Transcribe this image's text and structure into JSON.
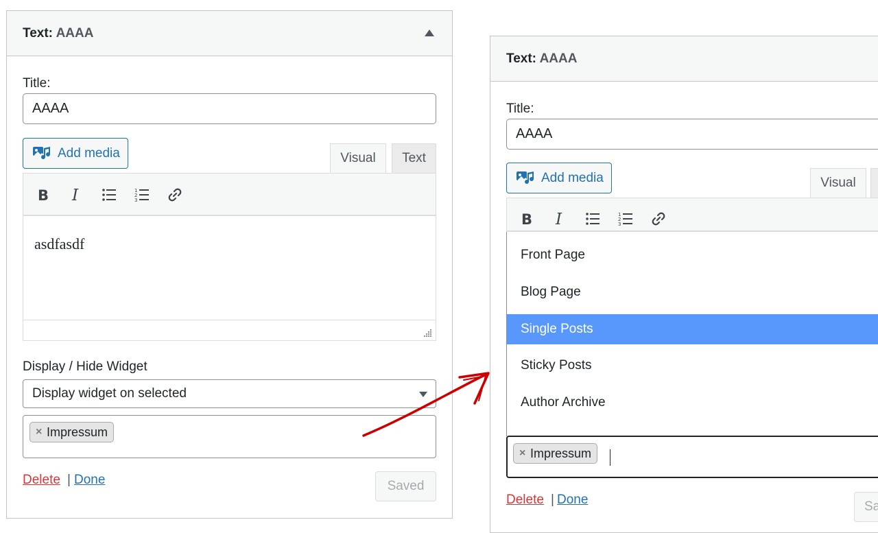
{
  "widget": {
    "type_label": "Text",
    "name": "AAAA",
    "title_label": "Title:",
    "title_value": "AAAA",
    "add_media_label": "Add media",
    "tabs": {
      "visual": "Visual",
      "text": "Text"
    },
    "editor_content": "asdfasdf",
    "display_label": "Display / Hide Widget",
    "display_selected": "Display widget on selected",
    "tags": [
      "Impressum"
    ],
    "tag_remove": "×",
    "delete_label": "Delete",
    "separator": "|",
    "done_label": "Done",
    "saved_label": "Saved",
    "saved_label_truncated": "Sa"
  },
  "dropdown": {
    "options": [
      "Front Page",
      "Blog Page",
      "Single Posts",
      "Sticky Posts",
      "Author Archive"
    ],
    "highlighted_index": 2
  },
  "colors": {
    "link_blue": "#2271b1",
    "delete_red": "#d63638",
    "highlight": "#5897fb",
    "annotation_arrow": "#cc0000"
  }
}
